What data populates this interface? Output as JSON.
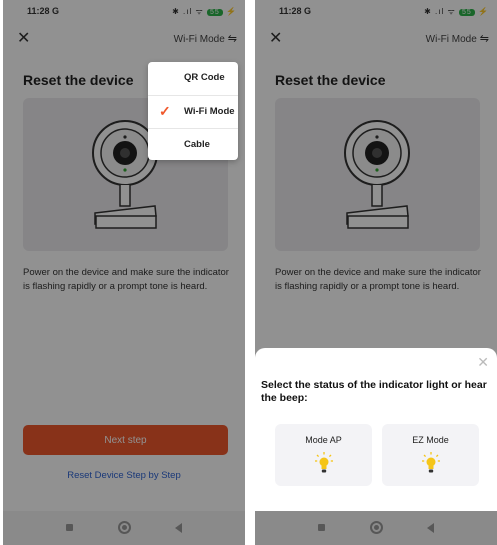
{
  "status_bar": {
    "time": "11:28",
    "carrier_icon": "G",
    "icons": "✱ .ıl ᯤ ",
    "battery": "55",
    "charging": "⚡"
  },
  "header": {
    "mode_label": "Wi-Fi Mode",
    "mode_icon": "⇋",
    "close_icon": "✕"
  },
  "page": {
    "title": "Reset the device",
    "description": "Power on the device and make sure the indicator is flashing rapidly or a prompt tone is heard.",
    "next_button": "Next step",
    "reset_link": "Reset Device Step by Step"
  },
  "mode_menu": {
    "items": [
      {
        "label": "QR Code",
        "selected": false
      },
      {
        "label": "Wi-Fi Mode",
        "selected": true
      },
      {
        "label": "Cable",
        "selected": false
      }
    ],
    "check_glyph": "✓"
  },
  "sheet": {
    "title": "Select the status of the indicator light or hear the beep:",
    "close_icon": "✕",
    "options": [
      {
        "label": "Mode AP"
      },
      {
        "label": "EZ Mode"
      }
    ]
  },
  "colors": {
    "accent": "#f0582c",
    "link": "#2f64d4",
    "bulb": "#f5c518"
  }
}
